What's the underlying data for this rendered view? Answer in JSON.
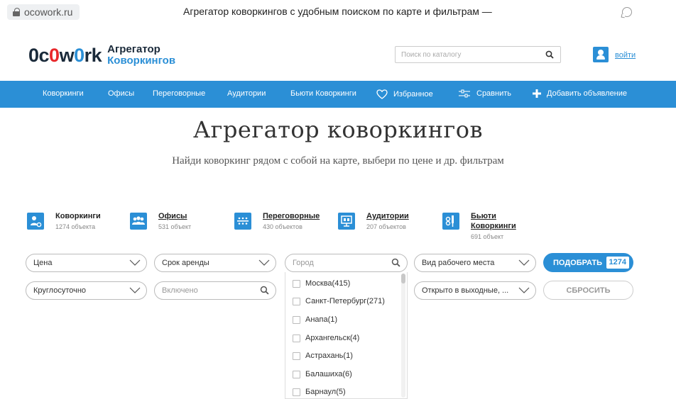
{
  "browser": {
    "url": "ocowork.ru",
    "title": "Агрегатор коворкингов с удобным поиском по карте и фильтрам —"
  },
  "header": {
    "logo_part1": "0c",
    "logo_part2": "0",
    "logo_part3": "w",
    "logo_part4": "0",
    "logo_part5": "rk",
    "tagline_line1": "Агрегатор",
    "tagline_line2": "Коворкингов",
    "search_placeholder": "Поиск по каталогу",
    "login_label": "войти"
  },
  "nav": {
    "items": [
      {
        "label": "Коворкинги"
      },
      {
        "label": "Офисы"
      },
      {
        "label": "Переговорные"
      },
      {
        "label": "Аудитории"
      },
      {
        "label": "Бьюти Коворкинги"
      },
      {
        "label": "Избранное"
      },
      {
        "label": "Сравнить"
      },
      {
        "label": "Добавить объявление"
      }
    ]
  },
  "hero": {
    "title": "Агрегатор коворкингов",
    "subtitle": "Найди коворкинг рядом с собой на карте, выбери по цене и др. фильтрам"
  },
  "categories": [
    {
      "name": "Коворкинги",
      "count": "1274 объекта"
    },
    {
      "name": "Офисы",
      "count": "531 объект"
    },
    {
      "name": "Переговорные",
      "count": "430 объектов"
    },
    {
      "name": "Аудитории",
      "count": "207 объектов"
    },
    {
      "name_line1": "Бьюти",
      "name_line2": "Коворкинги",
      "count": "691 объект"
    }
  ],
  "filters": {
    "price": "Цена",
    "rent_term": "Срок аренды",
    "city_placeholder": "Город",
    "workplace_type": "Вид рабочего места",
    "hours": "Круглосуточно",
    "included_placeholder": "Включено",
    "weekends": "Открыто в выходные, ...",
    "pick_label": "ПОДОБРАТЬ",
    "pick_count": "1274",
    "reset_label": "СБРОСИТЬ"
  },
  "city_dropdown": {
    "options": [
      "Москва(415)",
      "Санкт-Петербург(271)",
      "Анапа(1)",
      "Архангельск(4)",
      "Астрахань(1)",
      "Балашиха(6)",
      "Барнаул(5)"
    ]
  },
  "colors": {
    "brand_blue": "#2b8fd6",
    "logo_red": "#e8282b",
    "logo_dark": "#1a2a3a"
  }
}
